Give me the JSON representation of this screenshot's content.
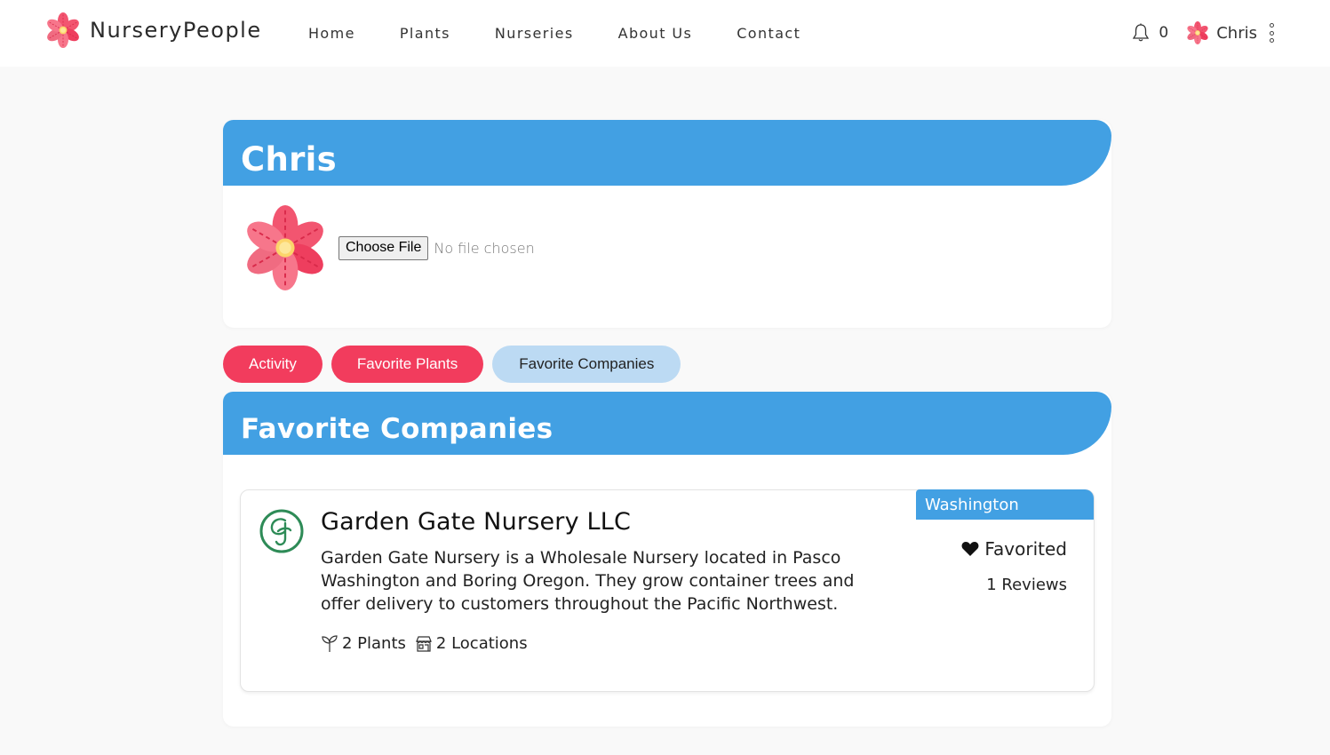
{
  "nav": {
    "brand": "NurseryPeople",
    "links": [
      "Home",
      "Plants",
      "Nurseries",
      "About Us",
      "Contact"
    ],
    "notification_count": "0",
    "user_name": "Chris"
  },
  "profile": {
    "name": "Chris",
    "file_button_label": "Choose File",
    "file_status": "No file chosen"
  },
  "tabs": [
    {
      "label": "Activity",
      "active": false
    },
    {
      "label": "Favorite Plants",
      "active": false
    },
    {
      "label": "Favorite Companies",
      "active": true
    }
  ],
  "favorites": {
    "title": "Favorite Companies",
    "companies": [
      {
        "name": "Garden Gate Nursery LLC",
        "description": "Garden Gate Nursery is a Wholesale Nursery located in Pasco Washington and Boring Oregon. They grow container trees and offer delivery to customers throughout the Pacific Northwest.",
        "plants": "2 Plants",
        "locations": "2 Locations",
        "region": "Washington",
        "favorited_label": "Favorited",
        "reviews": "1 Reviews"
      }
    ]
  },
  "colors": {
    "accent_blue": "#42a0e3",
    "tab_red": "#f23c5d",
    "tab_active": "#bcdaf3",
    "logo_green": "#2e8b57"
  }
}
